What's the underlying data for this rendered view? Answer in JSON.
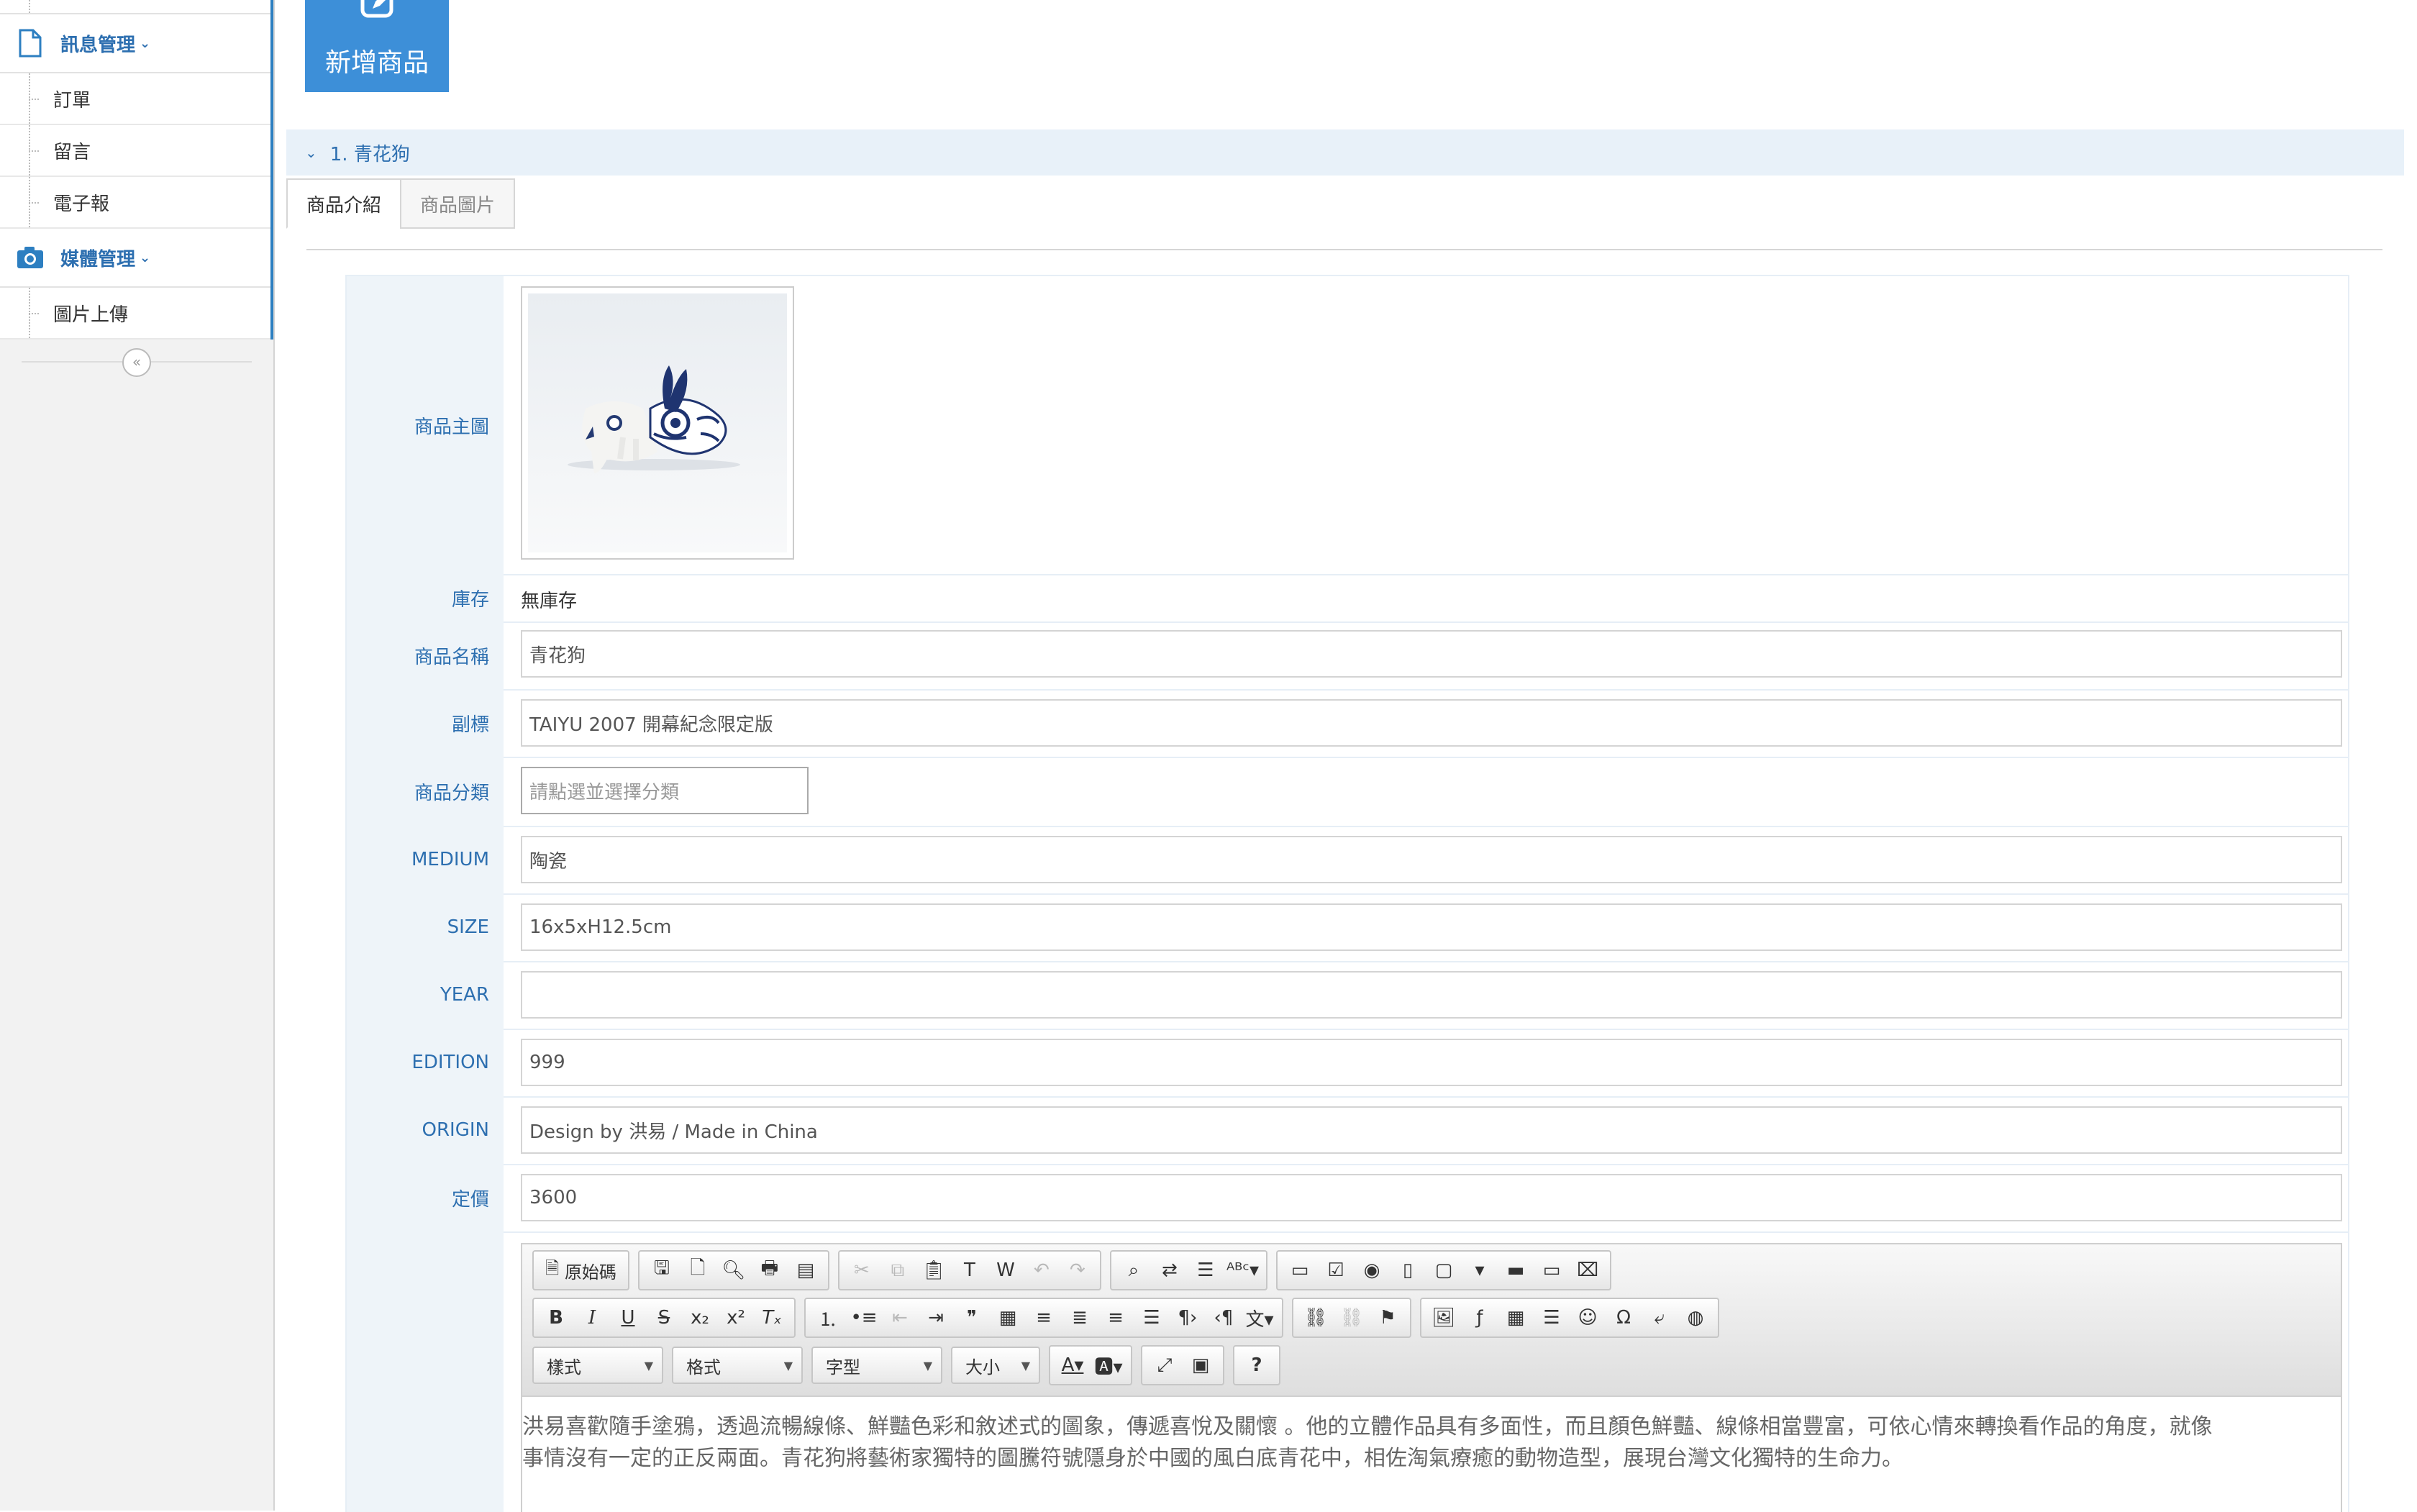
{
  "sidebar": {
    "sections": [
      {
        "title": "訊息管理",
        "icon": "file-icon",
        "items": [
          "訂單",
          "留言",
          "電子報"
        ]
      },
      {
        "title": "媒體管理",
        "icon": "camera-icon",
        "items": [
          "圖片上傳"
        ]
      }
    ],
    "collapse_icon": "double-chevron-left-icon"
  },
  "toolbar": {
    "add_product_label": "新增商品"
  },
  "section": {
    "title": "1. 青花狗"
  },
  "tabs": [
    {
      "label": "商品介紹",
      "active": true
    },
    {
      "label": "商品圖片",
      "active": false
    }
  ],
  "form": {
    "main_image_label": "商品主圖",
    "stock": {
      "label": "庫存",
      "value": "無庫存"
    },
    "name": {
      "label": "商品名稱",
      "value": "青花狗"
    },
    "subtitle": {
      "label": "副標",
      "value": "TAIYU 2007 開幕紀念限定版"
    },
    "category": {
      "label": "商品分類",
      "placeholder": "請點選並選擇分類"
    },
    "medium": {
      "label": "MEDIUM",
      "value": "陶瓷"
    },
    "size": {
      "label": "SIZE",
      "value": "16x5xH12.5cm"
    },
    "year": {
      "label": "YEAR",
      "value": ""
    },
    "edition": {
      "label": "EDITION",
      "value": "999"
    },
    "origin": {
      "label": "ORIGIN",
      "value": "Design by 洪易 / Made in China"
    },
    "price": {
      "label": "定價",
      "value": "3600"
    }
  },
  "editor": {
    "source_label": "原始碼",
    "combos": {
      "style": "樣式",
      "format": "格式",
      "font": "字型",
      "size": "大小"
    },
    "content_lines": [
      "洪易喜歡隨手塗鴉，透過流暢線條、鮮豔色彩和敘述式的圖象，傳遞喜悅及關懷 。他的立體作品具有多面性，而且顏色鮮豔、線條相當豐富，可依心情來轉換看作品的角度，就像",
      "事情沒有一定的正反兩面。青花狗將藝術家獨特的圖騰符號隱身於中國的風白底青花中，相佐淘氣療癒的動物造型，展現台灣文化獨特的生命力。"
    ]
  },
  "colors": {
    "accent": "#3d8fd8",
    "label_text": "#2d6fb0",
    "label_bg": "#eef4f9"
  }
}
